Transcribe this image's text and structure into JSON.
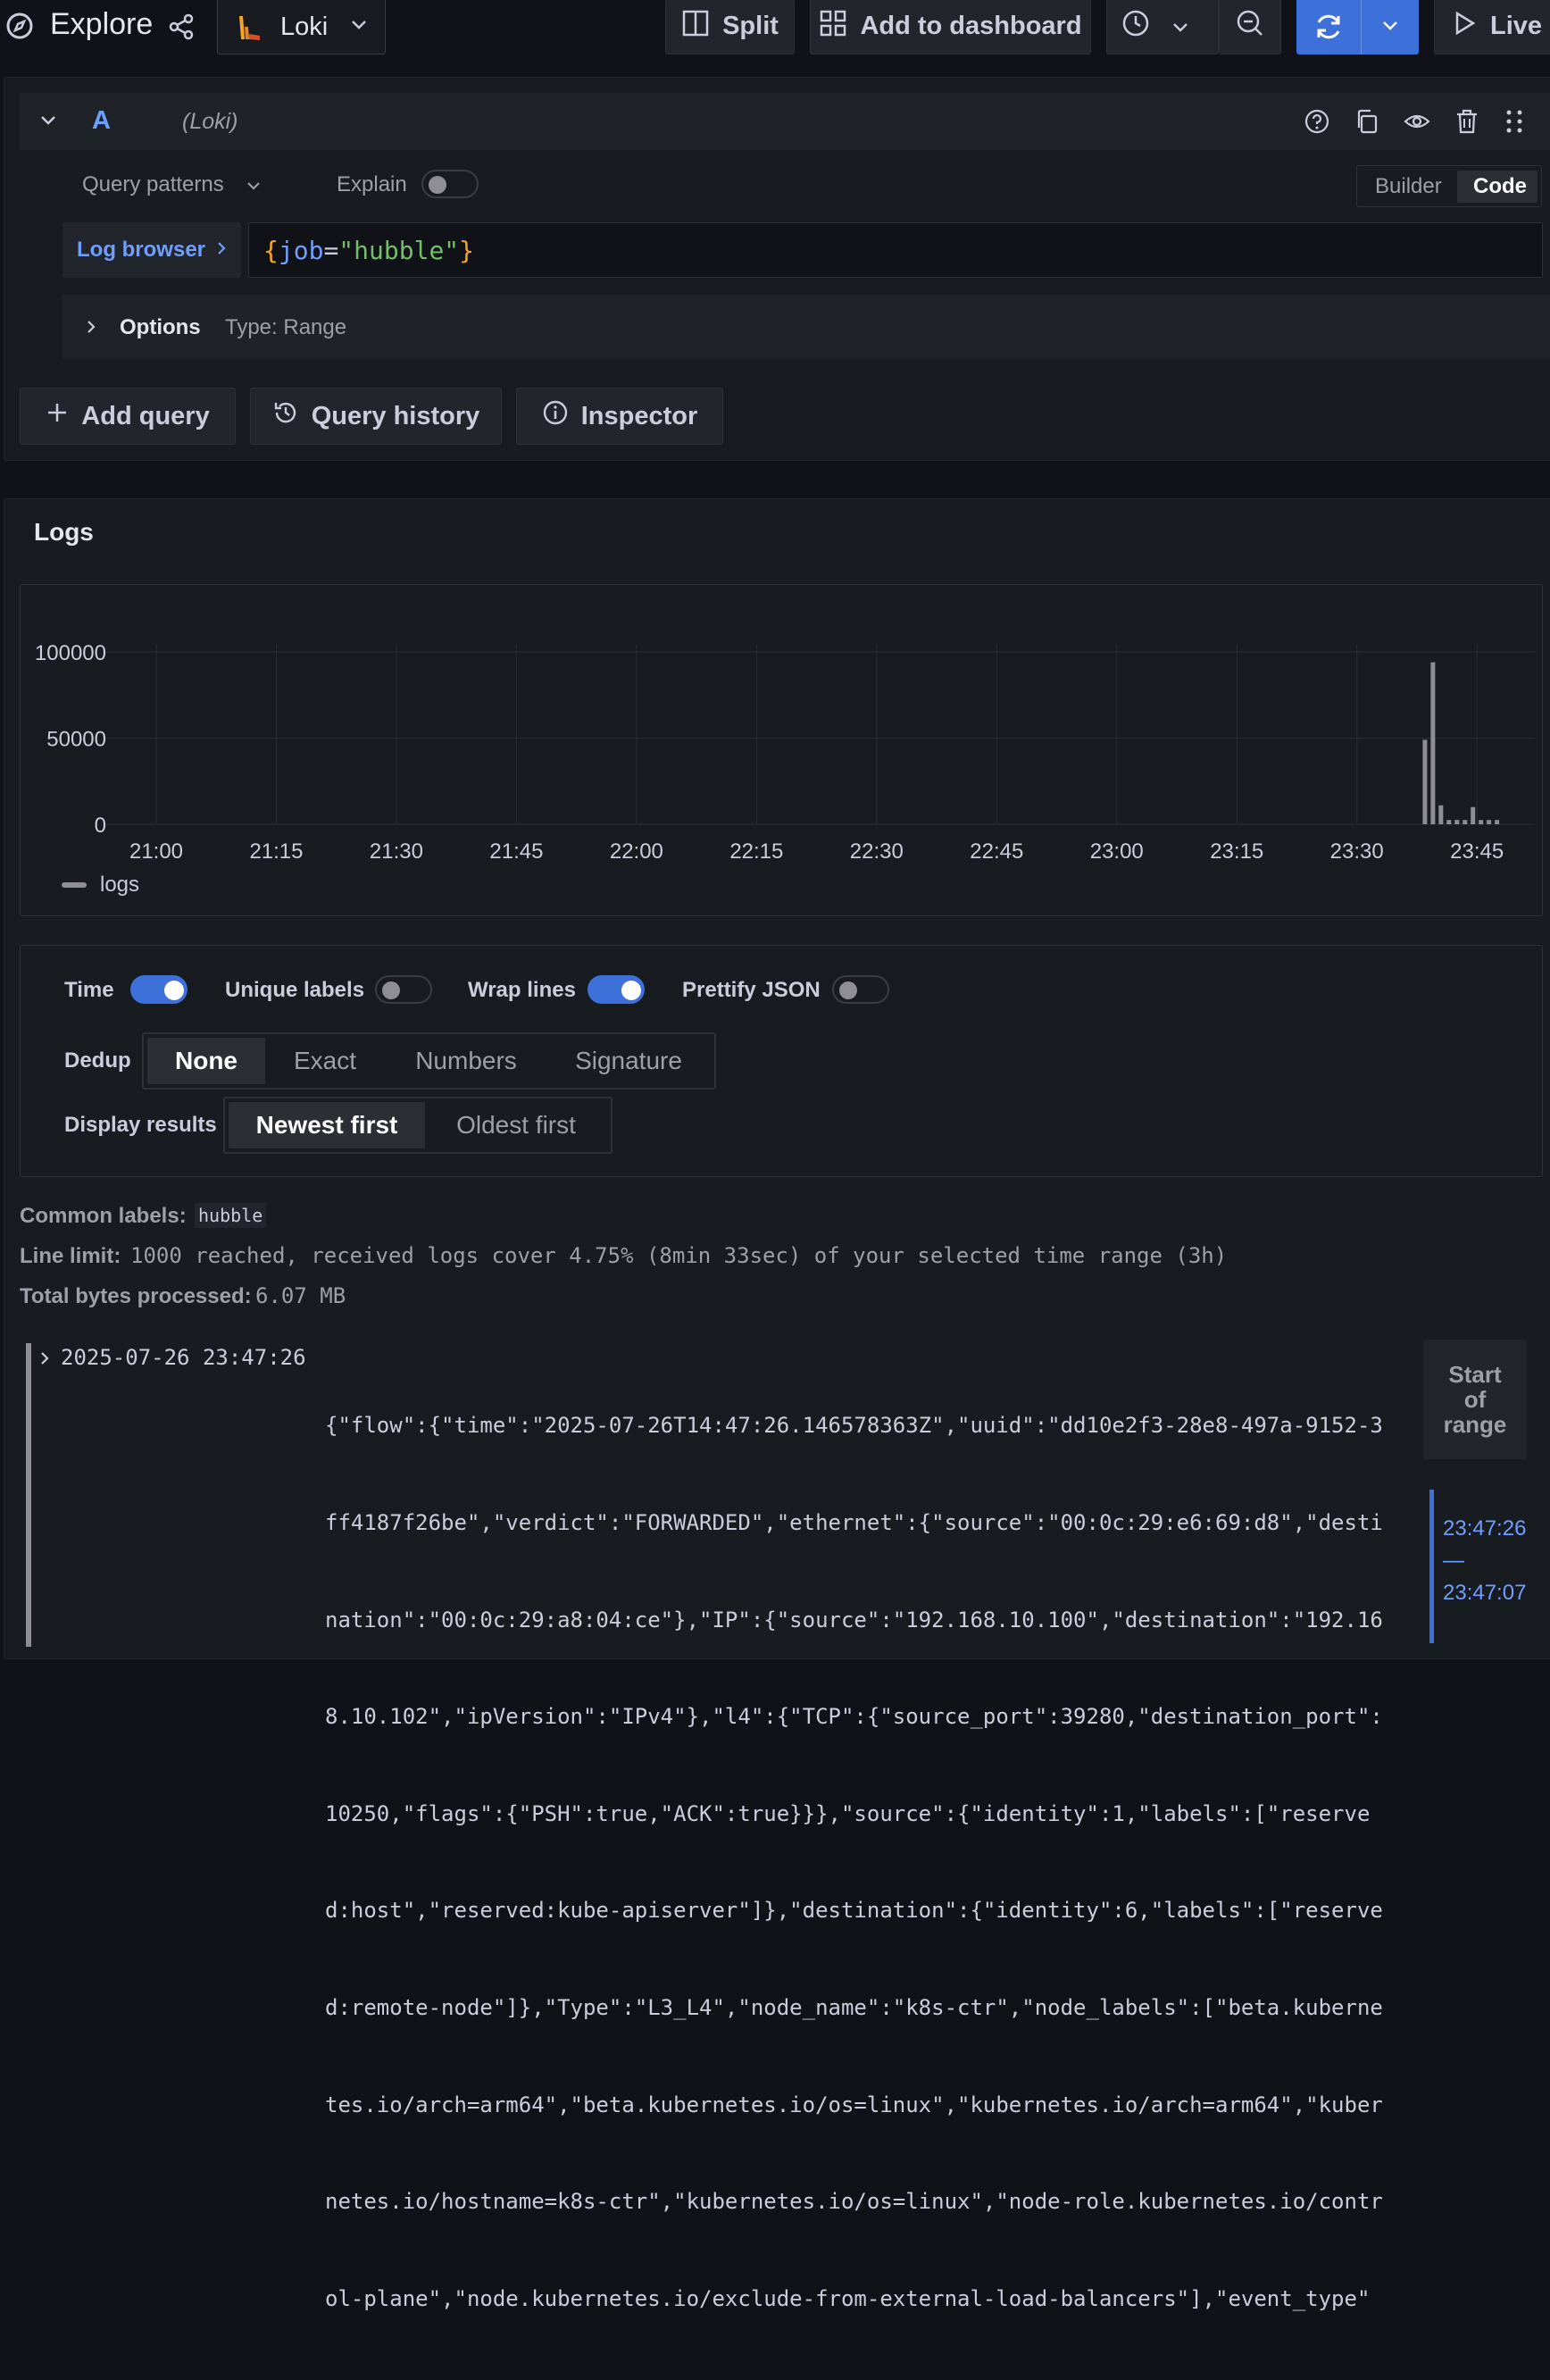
{
  "header": {
    "title": "Explore",
    "datasource": "Loki",
    "split_label": "Split",
    "add_to_dashboard_label": "Add to dashboard",
    "live_label": "Live"
  },
  "query": {
    "ref_id": "A",
    "datasource_hint": "(Loki)",
    "query_patterns_label": "Query patterns",
    "explain_label": "Explain",
    "explain_on": false,
    "mode_builder": "Builder",
    "mode_code": "Code",
    "active_mode": "Code",
    "log_browser_label": "Log browser",
    "expr_open": "{",
    "expr_key": "job",
    "expr_eq": "=",
    "expr_value": "\"hubble\"",
    "expr_close": "}",
    "options_label": "Options",
    "options_type": "Type: Range"
  },
  "actions": {
    "add_query": "Add query",
    "query_history": "Query history",
    "inspector": "Inspector"
  },
  "logs_panel": {
    "title": "Logs",
    "legend": "logs"
  },
  "chart_data": {
    "type": "bar",
    "x": [
      "23:38:30",
      "23:39:30",
      "23:40:30",
      "23:41:30",
      "23:42:30",
      "23:43:30",
      "23:44:30",
      "23:45:30",
      "23:46:30",
      "23:47:30"
    ],
    "values": [
      49000,
      94000,
      11000,
      2500,
      2500,
      2500,
      10000,
      2500,
      2500,
      2500
    ],
    "xticks": [
      "21:00",
      "21:15",
      "21:30",
      "21:45",
      "22:00",
      "22:15",
      "22:30",
      "22:45",
      "23:00",
      "23:15",
      "23:30",
      "23:45"
    ],
    "yticks": [
      "0",
      "50000",
      "100000"
    ],
    "ylim": [
      0,
      100000
    ],
    "series": [
      {
        "name": "logs",
        "color": "#8e8e94"
      }
    ],
    "grid": true,
    "legend_position": "bottom-left"
  },
  "options": {
    "time_label": "Time",
    "time_on": true,
    "unique_labels_label": "Unique labels",
    "unique_labels_on": false,
    "wrap_lines_label": "Wrap lines",
    "wrap_lines_on": true,
    "prettify_json_label": "Prettify JSON",
    "prettify_json_on": false,
    "dedup_label": "Dedup",
    "dedup_options": [
      "None",
      "Exact",
      "Numbers",
      "Signature"
    ],
    "dedup_selected": "None",
    "display_results_label": "Display results",
    "display_options": [
      "Newest first",
      "Oldest first"
    ],
    "display_selected": "Newest first"
  },
  "meta": {
    "common_labels_key": "Common labels:",
    "common_labels_value": "hubble",
    "line_limit_key": "Line limit:",
    "line_limit_value": "1000 reached, received logs cover 4.75% (8min 33sec) of your selected time range (3h)",
    "bytes_key": "Total bytes processed:",
    "bytes_value": "6.07 MB"
  },
  "log_row": {
    "timestamp": "2025-07-26 23:47:26",
    "lines": [
      "{\"flow\":{\"time\":\"2025-07-26T14:47:26.146578363Z\",\"uuid\":\"dd10e2f3-28e8-497a-9152-3",
      "ff4187f26be\",\"verdict\":\"FORWARDED\",\"ethernet\":{\"source\":\"00:0c:29:e6:69:d8\",\"desti",
      "nation\":\"00:0c:29:a8:04:ce\"},\"IP\":{\"source\":\"192.168.10.100\",\"destination\":\"192.16",
      "8.10.102\",\"ipVersion\":\"IPv4\"},\"l4\":{\"TCP\":{\"source_port\":39280,\"destination_port\":",
      "10250,\"flags\":{\"PSH\":true,\"ACK\":true}}},\"source\":{\"identity\":1,\"labels\":[\"reserve",
      "d:host\",\"reserved:kube-apiserver\"]},\"destination\":{\"identity\":6,\"labels\":[\"reserve",
      "d:remote-node\"]},\"Type\":\"L3_L4\",\"node_name\":\"k8s-ctr\",\"node_labels\":[\"beta.kuberne",
      "tes.io/arch=arm64\",\"beta.kubernetes.io/os=linux\",\"kubernetes.io/arch=arm64\",\"kuber",
      "netes.io/hostname=k8s-ctr\",\"kubernetes.io/os=linux\",\"node-role.kubernetes.io/contr",
      "ol-plane\",\"node.kubernetes.io/exclude-from-external-load-balancers\"],\"event_type\""
    ]
  },
  "range_nav": {
    "start_label_1": "Start",
    "start_label_2": "of",
    "start_label_3": "range",
    "range_from": "23:47:26",
    "range_sep": "—",
    "range_to": "23:47:07"
  }
}
